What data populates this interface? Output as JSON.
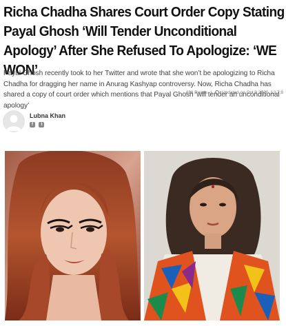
{
  "article": {
    "headline": "Richa Chadha Shares Court Order Copy Stating Payal Ghosh ‘Will Tender Unconditional Apology’ After She Refused To Apologize: ‘WE WON’",
    "summary": "Payal Ghosh recently took to her Twitter and wrote that she won’t be apologizing to Richa Chadha for dragging her name in Anurag Kashyap controversy. Now, Richa Chadha has shared a copy of court order which mentions that Payal Ghosh ‘will tender an unconditional apology’",
    "reads": "438 Reads",
    "separator": "|",
    "updated": "Updated on Oct 9 2020, 12:7:8"
  },
  "author": {
    "name": "Lubna Khan",
    "socials": [
      {
        "icon": "facebook-icon",
        "glyph": "f"
      },
      {
        "icon": "twitter-icon",
        "glyph": "t"
      }
    ]
  },
  "colors": {
    "headline": "#111111",
    "summary": "#444444",
    "meta": "#777777"
  }
}
